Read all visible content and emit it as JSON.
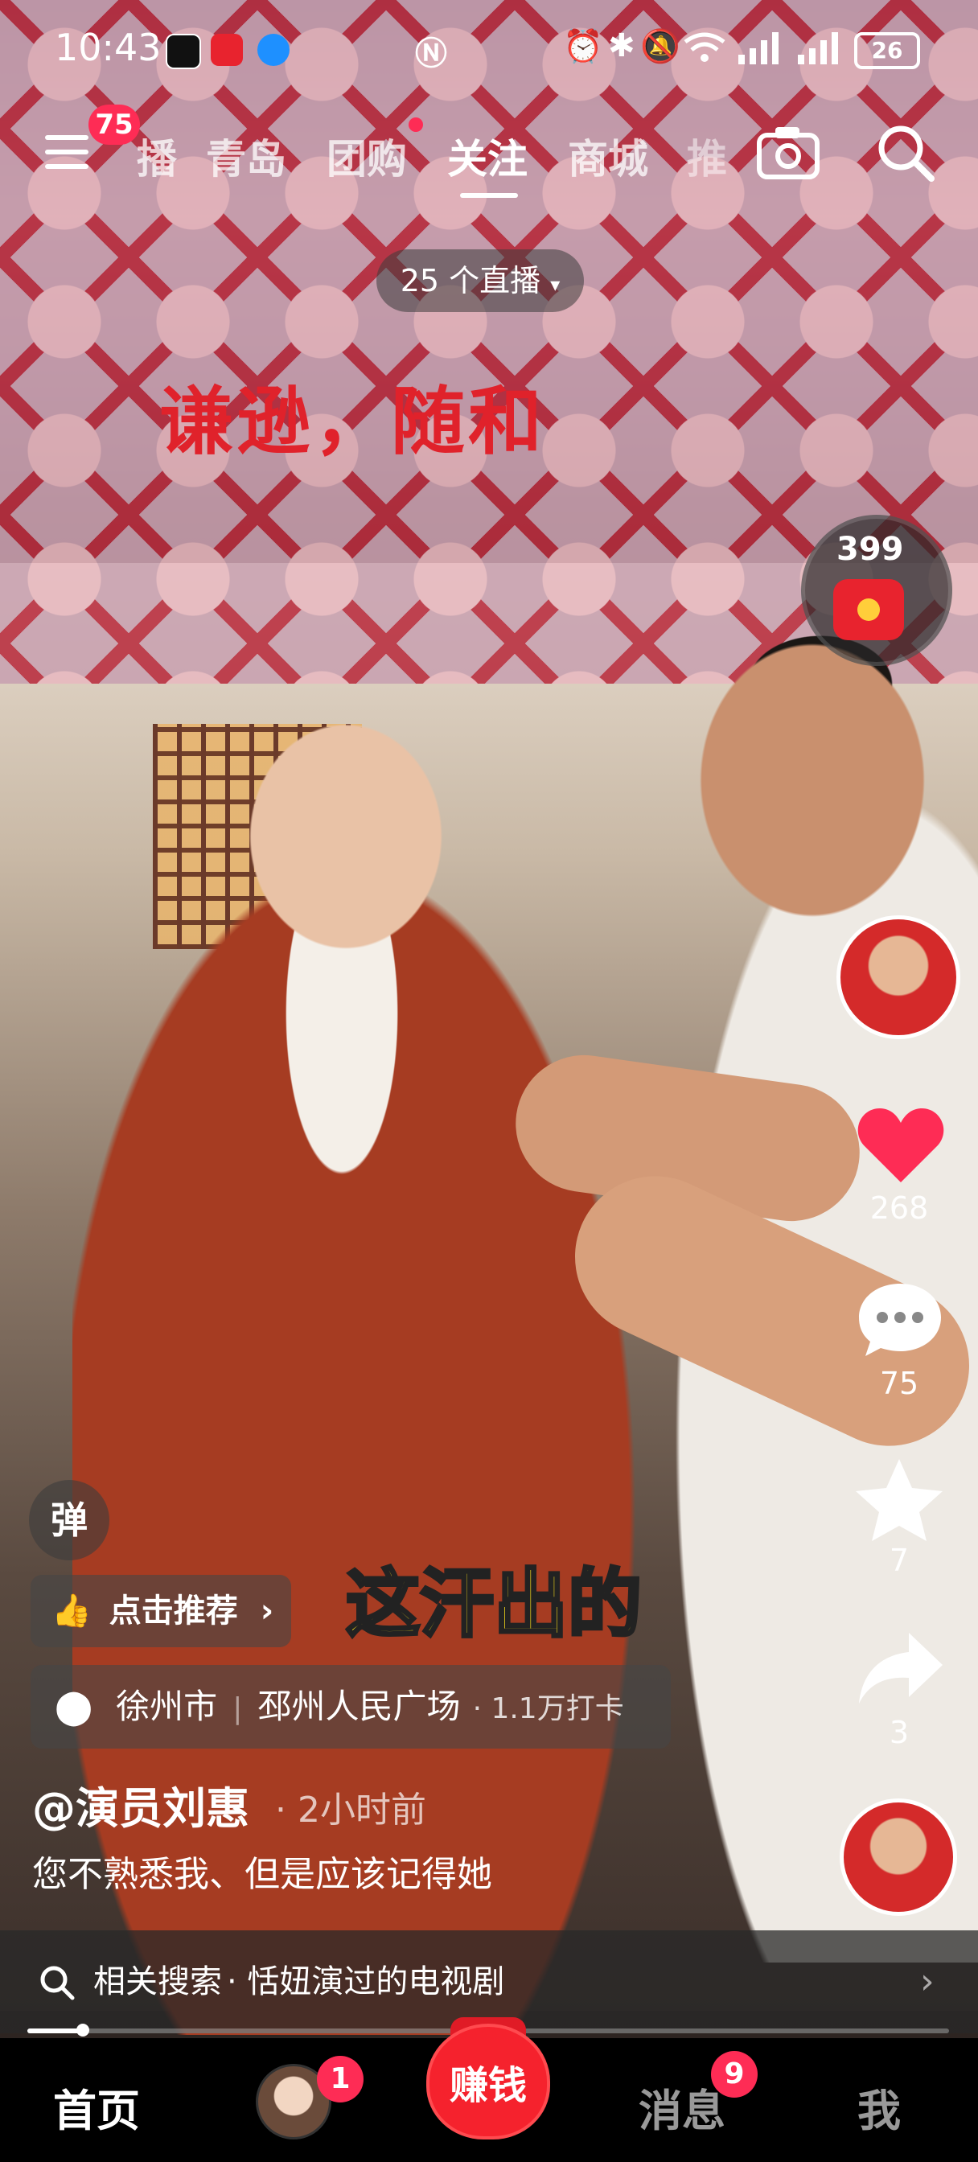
{
  "status_bar": {
    "time": "10:43",
    "battery": "26",
    "icons": [
      "qq-icon",
      "app-icon",
      "browser-icon",
      "nfc-icon",
      "alarm-icon",
      "bluetooth-icon",
      "mute-icon",
      "wifi-icon",
      "signal-icon",
      "signal-icon",
      "battery-icon"
    ]
  },
  "top_nav": {
    "menu_badge": "75",
    "tabs": [
      {
        "label": "播"
      },
      {
        "label": "青岛"
      },
      {
        "label": "团购"
      },
      {
        "label": "关注",
        "active": true
      },
      {
        "label": "商城"
      },
      {
        "label": "推"
      }
    ]
  },
  "live_pill": "25 个直播",
  "overlay_caption": "谦逊，随和",
  "subtitle": "这汗出的",
  "red_packet": {
    "count": "399"
  },
  "right_rail": {
    "likes": "268",
    "comments": "75",
    "favorites": "7",
    "shares": "3"
  },
  "danmaku_label": "弹",
  "recommend_label": "点击推荐",
  "location": {
    "city": "徐州市",
    "place": "邳州人民广场",
    "checkins": "· 1.1万打卡"
  },
  "author": "@演员刘惠",
  "post_time": "· 2小时前",
  "description": "您不熟悉我、但是应该记得她",
  "related_search": {
    "prefix": "相关搜索",
    "query": "· 恬妞演过的电视剧"
  },
  "progress": 0.06,
  "bottom_tabs": {
    "home": "首页",
    "friend_badge": "1",
    "earn": "赚钱",
    "messages": "消息",
    "messages_badge": "9",
    "me": "我"
  },
  "colors": {
    "accent": "#fe2c55",
    "caption_red": "#e0222b",
    "subtitle_yellow": "#ffe21a"
  }
}
